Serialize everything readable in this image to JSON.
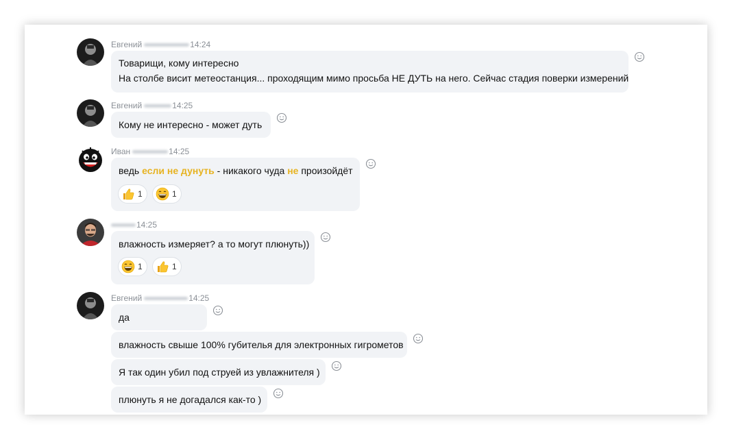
{
  "messages": [
    {
      "author": "Евгений",
      "time": "14:24",
      "lines": [
        "Товарищи, кому интересно",
        "На столбе висит метеостанция... проходящим мимо просьба НЕ ДУТЬ на него. Сейчас стадия поверки измерений"
      ]
    },
    {
      "author": "Евгений",
      "time": "14:25",
      "lines": [
        "Кому не интересно - может дуть"
      ]
    },
    {
      "author": "Иван",
      "time": "14:25",
      "segments": [
        "ведь ",
        "если не дунуть",
        " - никакого чуда ",
        "не",
        " произойдёт"
      ],
      "reactions": [
        {
          "icon": "thumbs-up-emoji",
          "count": "1"
        },
        {
          "icon": "laughing-emoji",
          "count": "1"
        }
      ]
    },
    {
      "author": "",
      "time": "14:25",
      "lines": [
        "влажность измеряет? а то могут плюнуть))"
      ],
      "reactions": [
        {
          "icon": "laughing-emoji",
          "count": "1"
        },
        {
          "icon": "thumbs-up-emoji",
          "count": "1"
        }
      ]
    },
    {
      "author": "Евгений",
      "time": "14:25",
      "bubbles": [
        "да",
        "влажность свыше 100% губителья для электронных гигрометов",
        "Я так один убил под струей из увлажнителя )",
        "плюнуть я не догадался как-то )"
      ]
    }
  ],
  "colors": {
    "bubble": "#f1f3f6",
    "highlight": "#e7b321",
    "meta_text": "#8a8f96"
  }
}
